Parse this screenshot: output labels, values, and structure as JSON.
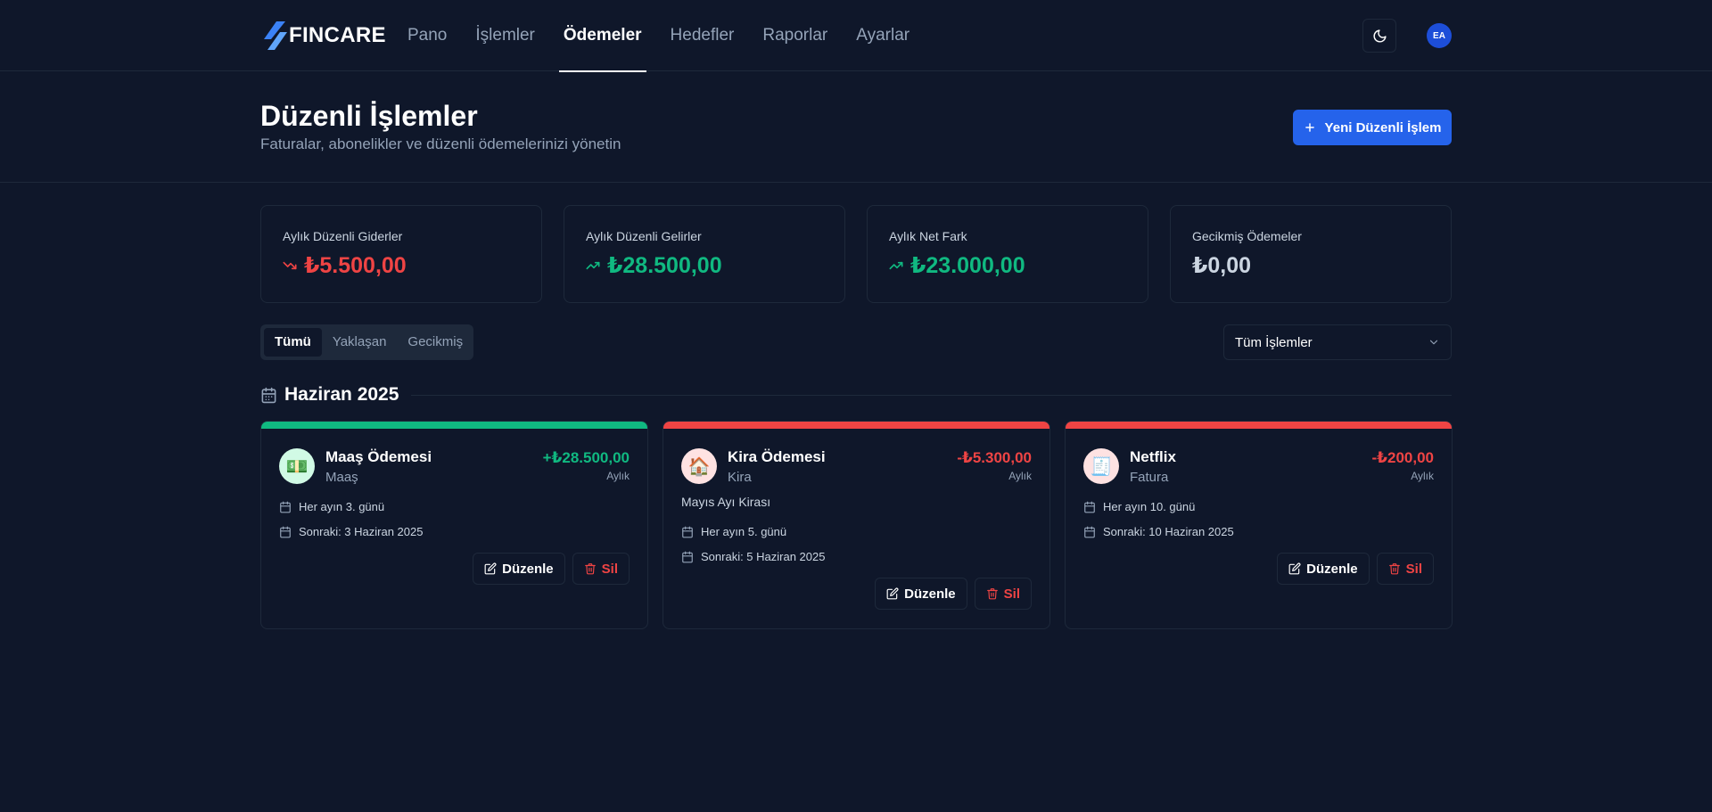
{
  "brand": {
    "name": "FINCARE"
  },
  "nav": {
    "links": [
      {
        "label": "Pano"
      },
      {
        "label": "İşlemler"
      },
      {
        "label": "Ödemeler",
        "active": true
      },
      {
        "label": "Hedefler"
      },
      {
        "label": "Raporlar"
      },
      {
        "label": "Ayarlar"
      }
    ],
    "theme_icon": "moon-icon",
    "avatar_initials": "EA"
  },
  "header": {
    "title": "Düzenli İşlemler",
    "subtitle": "Faturalar, abonelikler ve düzenli ödemelerinizi yönetin",
    "new_button": "Yeni Düzenli İşlem"
  },
  "stats": [
    {
      "label": "Aylık Düzenli Giderler",
      "value": "₺5.500,00",
      "trend": "down",
      "color": "#ef4444"
    },
    {
      "label": "Aylık Düzenli Gelirler",
      "value": "₺28.500,00",
      "trend": "up",
      "color": "#10b981"
    },
    {
      "label": "Aylık Net Fark",
      "value": "₺23.000,00",
      "trend": "up",
      "color": "#10b981"
    },
    {
      "label": "Gecikmiş Ödemeler",
      "value": "₺0,00",
      "trend": "none",
      "color": "#cbd5e1"
    }
  ],
  "tabs": [
    {
      "label": "Tümü",
      "active": true
    },
    {
      "label": "Yaklaşan"
    },
    {
      "label": "Gecikmiş"
    }
  ],
  "filter": {
    "selected": "Tüm İşlemler"
  },
  "month": {
    "title": "Haziran 2025"
  },
  "cards": [
    {
      "name": "Maaş Ödemesi",
      "category": "Maaş",
      "amount": "+₺28.500,00",
      "frequency": "Aylık",
      "description": "",
      "schedule": "Her ayın 3. günü",
      "next": "Sonraki: 3 Haziran 2025",
      "accent": "#10b981",
      "icon": "money-icon",
      "icon_bg": "#d1fae5",
      "edit_label": "Düzenle",
      "delete_label": "Sil"
    },
    {
      "name": "Kira Ödemesi",
      "category": "Kira",
      "amount": "-₺5.300,00",
      "frequency": "Aylık",
      "description": "Mayıs Ayı Kirası",
      "schedule": "Her ayın 5. günü",
      "next": "Sonraki: 5 Haziran 2025",
      "accent": "#ef4444",
      "icon": "house-icon",
      "icon_bg": "#fee2e2",
      "edit_label": "Düzenle",
      "delete_label": "Sil"
    },
    {
      "name": "Netflix",
      "category": "Fatura",
      "amount": "-₺200,00",
      "frequency": "Aylık",
      "description": "",
      "schedule": "Her ayın 10. günü",
      "next": "Sonraki: 10 Haziran 2025",
      "accent": "#ef4444",
      "icon": "receipt-icon",
      "icon_bg": "#fee2e2",
      "edit_label": "Düzenle",
      "delete_label": "Sil"
    }
  ]
}
